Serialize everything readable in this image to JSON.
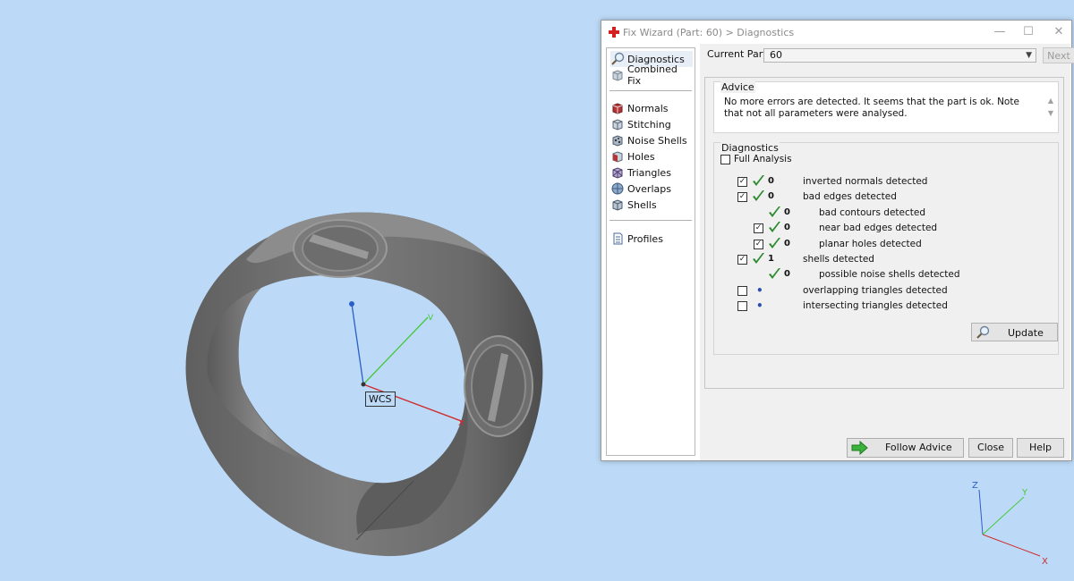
{
  "viewport": {
    "wcs_label": "WCS",
    "axis_gizmo": {
      "z": "Z",
      "y": "Y",
      "x": "X"
    }
  },
  "dialog": {
    "title": "Fix Wizard (Part: 60) > Diagnostics",
    "window_buttons": {
      "minimize": "—",
      "maximize": "☐",
      "close": "✕"
    },
    "sidebar": {
      "group1": [
        {
          "label": "Diagnostics",
          "icon": "magnifier-icon",
          "selected": true
        },
        {
          "label": "Combined Fix",
          "icon": "cube-icon"
        }
      ],
      "group2": [
        {
          "label": "Normals",
          "icon": "normals-icon"
        },
        {
          "label": "Stitching",
          "icon": "stitching-icon"
        },
        {
          "label": "Noise Shells",
          "icon": "noise-shells-icon"
        },
        {
          "label": "Holes",
          "icon": "holes-icon"
        },
        {
          "label": "Triangles",
          "icon": "triangles-icon"
        },
        {
          "label": "Overlaps",
          "icon": "overlaps-icon"
        },
        {
          "label": "Shells",
          "icon": "shells-icon"
        }
      ],
      "group3": [
        {
          "label": "Profiles",
          "icon": "profiles-icon"
        }
      ]
    },
    "current_part": {
      "label": "Current Part:",
      "value": "60",
      "next_label": "Next"
    },
    "advice": {
      "title": "Advice",
      "text": "No more errors are detected. It seems that the part is ok. Note that not all parameters were analysed."
    },
    "diagnostics": {
      "title": "Diagnostics",
      "full_analysis": {
        "label": "Full Analysis",
        "checked": false
      },
      "rows": [
        {
          "checkbox": true,
          "checked": true,
          "status": "ok",
          "count": "0",
          "label": "inverted normals detected",
          "indent": 0
        },
        {
          "checkbox": true,
          "checked": true,
          "status": "ok",
          "count": "0",
          "label": "bad edges detected",
          "indent": 0
        },
        {
          "checkbox": false,
          "checked": false,
          "status": "ok",
          "count": "0",
          "label": "bad contours detected",
          "indent": 1
        },
        {
          "checkbox": true,
          "checked": true,
          "status": "ok",
          "count": "0",
          "label": "near bad edges detected",
          "indent": 1
        },
        {
          "checkbox": true,
          "checked": true,
          "status": "ok",
          "count": "0",
          "label": "planar holes detected",
          "indent": 1
        },
        {
          "checkbox": true,
          "checked": true,
          "status": "ok",
          "count": "1",
          "label": "shells detected",
          "indent": 0
        },
        {
          "checkbox": false,
          "checked": false,
          "status": "ok",
          "count": "0",
          "label": "possible noise shells detected",
          "indent": 1
        },
        {
          "checkbox": true,
          "checked": false,
          "status": "pending",
          "count": "",
          "label": "overlapping triangles detected",
          "indent": 0
        },
        {
          "checkbox": true,
          "checked": false,
          "status": "pending",
          "count": "",
          "label": "intersecting triangles detected",
          "indent": 0
        }
      ],
      "update_label": "Update"
    },
    "buttons": {
      "follow_advice": "Follow Advice",
      "close": "Close",
      "help": "Help"
    },
    "colors": {
      "check_green": "#2e8b2e",
      "app_red": "#d42020",
      "background": "#bcdaf7"
    }
  }
}
